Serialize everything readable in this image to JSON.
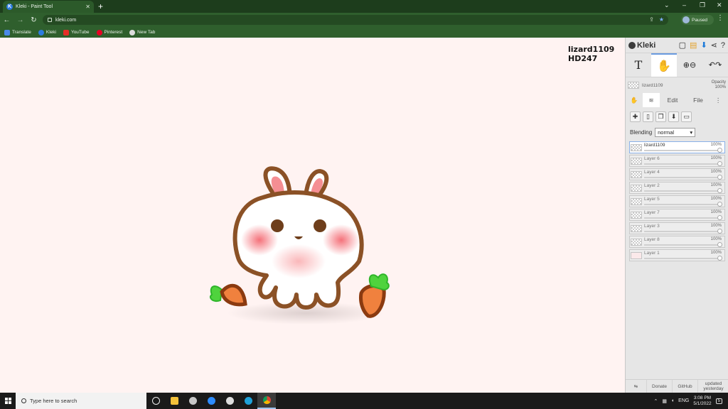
{
  "browser": {
    "tab_title": "Kleki - Paint Tool",
    "tab_favicon_letter": "K",
    "new_tab_symbol": "+",
    "url": "kleki.com",
    "profile_label": "Paused",
    "window_controls": [
      "⌄",
      "–",
      "❐",
      "✕"
    ],
    "bookmarks": [
      {
        "label": "Translate",
        "color": "#4a89e8"
      },
      {
        "label": "Kleki",
        "color": "#2d7ce0"
      },
      {
        "label": "YouTube",
        "color": "#e52d27"
      },
      {
        "label": "Pinterest",
        "color": "#e60023"
      },
      {
        "label": "New Tab",
        "color": "#dddddd"
      }
    ]
  },
  "canvas": {
    "watermark_line1": "lizard1109",
    "watermark_line2": "HD247"
  },
  "kleki": {
    "logo": "Kleki",
    "current_layer_name": "lizard1109",
    "opacity_label": "Opacity",
    "opacity_value": "100%",
    "tabs": {
      "edit": "Edit",
      "file": "File"
    },
    "blending_label": "Blending",
    "blending_value": "normal",
    "layers": [
      {
        "name": "lizard1109",
        "opacity": "100%",
        "active": true
      },
      {
        "name": "Layer 6",
        "opacity": "100%"
      },
      {
        "name": "Layer 4",
        "opacity": "100%"
      },
      {
        "name": "Layer 2",
        "opacity": "100%"
      },
      {
        "name": "Layer 5",
        "opacity": "100%"
      },
      {
        "name": "Layer 7",
        "opacity": "100%"
      },
      {
        "name": "Layer 3",
        "opacity": "100%"
      },
      {
        "name": "Layer 8",
        "opacity": "100%"
      },
      {
        "name": "Layer 1",
        "opacity": "100%"
      }
    ],
    "footer": {
      "donate": "Donate",
      "github": "GitHub",
      "updated_line1": "updated",
      "updated_line2": "yesterday"
    }
  },
  "taskbar": {
    "search_placeholder": "Type here to search",
    "lang": "ENG",
    "time": "3:08 PM",
    "date": "5/1/2022",
    "notification_count": "5"
  },
  "colors": {
    "browser_dark": "#1d3d1c",
    "browser_toolbar": "#2f5f2d",
    "canvas_bg": "#fff3f2",
    "bunny_outline": "#8b5126",
    "blush": "#f27a80",
    "carrot": "#f0813e",
    "carrot_leaf": "#4fd33d"
  }
}
